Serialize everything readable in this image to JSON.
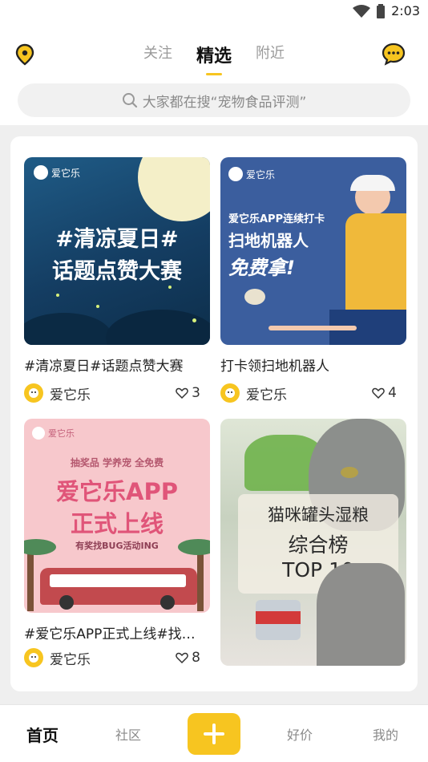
{
  "status": {
    "time": "2:03"
  },
  "header": {
    "tabs": [
      {
        "label": "关注"
      },
      {
        "label": "精选"
      },
      {
        "label": "附近"
      }
    ]
  },
  "search": {
    "placeholder": "大家都在搜“宠物食品评测”"
  },
  "cards": [
    {
      "title": "#清凉夏日#话题点赞大赛",
      "author": "爱它乐",
      "likes": "3",
      "image": {
        "brand": "爱它乐",
        "line1": "#清凉夏日#",
        "line2": "话题点赞大赛"
      }
    },
    {
      "title": "打卡领扫地机器人",
      "author": "爱它乐",
      "likes": "4",
      "image": {
        "brand": "爱它乐",
        "line1": "爱它乐APP连续打卡",
        "line2": "扫地机器人",
        "line3": "免费拿!"
      }
    },
    {
      "title": "#爱它乐APP正式上线#找…",
      "author": "爱它乐",
      "likes": "8",
      "image": {
        "brand": "爱它乐",
        "line0": "抽奖品 学养宠 全免费",
        "line1": "爱它乐APP",
        "line2": "正式上线",
        "line3": "有奖找BUG活动ING"
      }
    },
    {
      "image": {
        "line1": "猫咪罐头湿粮",
        "line2": "综合榜",
        "line3": "TOP 10"
      }
    }
  ],
  "bottom_nav": {
    "home": "首页",
    "community": "社区",
    "deals": "好价",
    "mine": "我的"
  },
  "colors": {
    "accent": "#f7c520"
  }
}
